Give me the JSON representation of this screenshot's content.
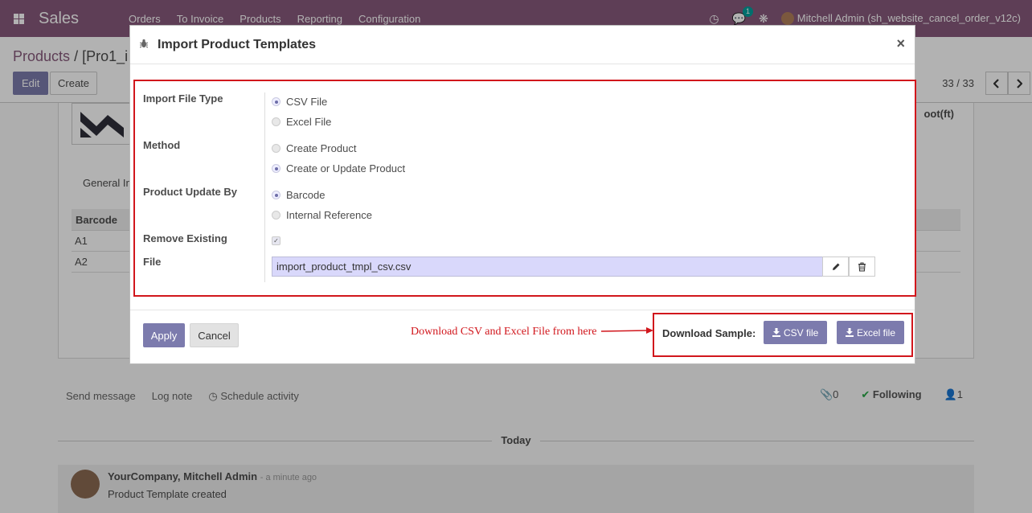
{
  "navbar": {
    "brand": "Sales",
    "menu": [
      "Orders",
      "To Invoice",
      "Products",
      "Reporting",
      "Configuration"
    ],
    "chat_badge": "1",
    "user": "Mitchell Admin (sh_website_cancel_order_v12c)"
  },
  "control_panel": {
    "breadcrumb_root": "Products",
    "breadcrumb_sep": "/",
    "breadcrumb_current": "[Pro1_i",
    "edit_label": "Edit",
    "create_label": "Create",
    "pager": "33 / 33"
  },
  "sheet": {
    "tab_label": "General In",
    "column_header": "Barcode",
    "rows": [
      "A1",
      "A2"
    ],
    "right_label": "oot(ft)"
  },
  "chatter": {
    "send_message": "Send message",
    "log_note": "Log note",
    "schedule_activity": "Schedule activity",
    "attachments": "0",
    "following": "Following",
    "followers": "1",
    "today": "Today",
    "message": {
      "author": "YourCompany, Mitchell Admin",
      "date": "- a minute ago",
      "body": "Product Template created"
    }
  },
  "modal": {
    "title": "Import Product Templates",
    "close": "×",
    "fields": {
      "import_file_type": {
        "label": "Import File Type",
        "options": [
          "CSV File",
          "Excel File"
        ],
        "selected": "CSV File"
      },
      "method": {
        "label": "Method",
        "options": [
          "Create Product",
          "Create or Update Product"
        ],
        "selected": "Create or Update Product"
      },
      "product_update_by": {
        "label": "Product Update By",
        "options": [
          "Barcode",
          "Internal Reference"
        ],
        "selected": "Barcode"
      },
      "remove_existing": {
        "label": "Remove Existing",
        "checked": true
      },
      "file": {
        "label": "File",
        "value": "import_product_tmpl_csv.csv"
      }
    },
    "footer": {
      "apply_label": "Apply",
      "cancel_label": "Cancel",
      "annotation": "Download CSV and Excel File from here",
      "download_label": "Download Sample:",
      "csv_button": "CSV file",
      "excel_button": "Excel file"
    },
    "accent_color": "#7c7bad",
    "annotation_color": "#d1161c"
  }
}
